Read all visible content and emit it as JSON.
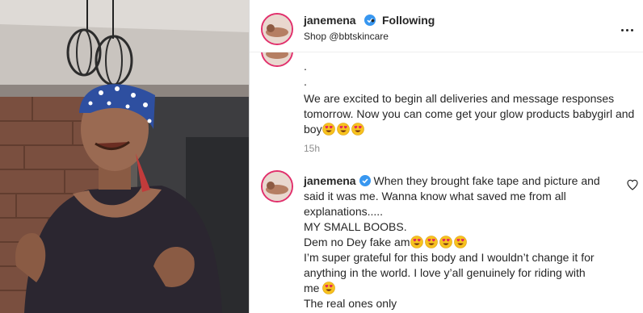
{
  "post": {
    "username": "janemena",
    "follow_status": "Following",
    "shop_text": "Shop @bbtskincare",
    "dot_separator": "•"
  },
  "caption_continued": {
    "line1": ".",
    "line2": ".",
    "text": "We are excited to begin all deliveries and message responses tomorrow. Now you can come get your glow products babygirl and boy",
    "emoji_count": 3
  },
  "timestamp": "15h",
  "comment": {
    "username": "janemena",
    "intro": "When they brought fake tape and picture and said it was me. Wanna know what saved me from all explanations.....",
    "line2": "MY SMALL BOOBS.",
    "line3": "Dem no Dey fake am",
    "line3_emoji_count": 4,
    "line4": "I’m super grateful for this body and I wouldn’t change it for anything in the world. I love y’all genuinely for riding with me",
    "line4_emoji_count": 1,
    "line5": "The real ones only"
  },
  "icons": {
    "verified": "verified-badge-icon",
    "more": "more-options-icon",
    "like": "heart-icon",
    "emoji": "heart-eyes-emoji"
  },
  "colors": {
    "verified_blue": "#3897f0",
    "story_ring": "#e1306c",
    "muted": "#8e8e8e",
    "text": "#262626"
  }
}
